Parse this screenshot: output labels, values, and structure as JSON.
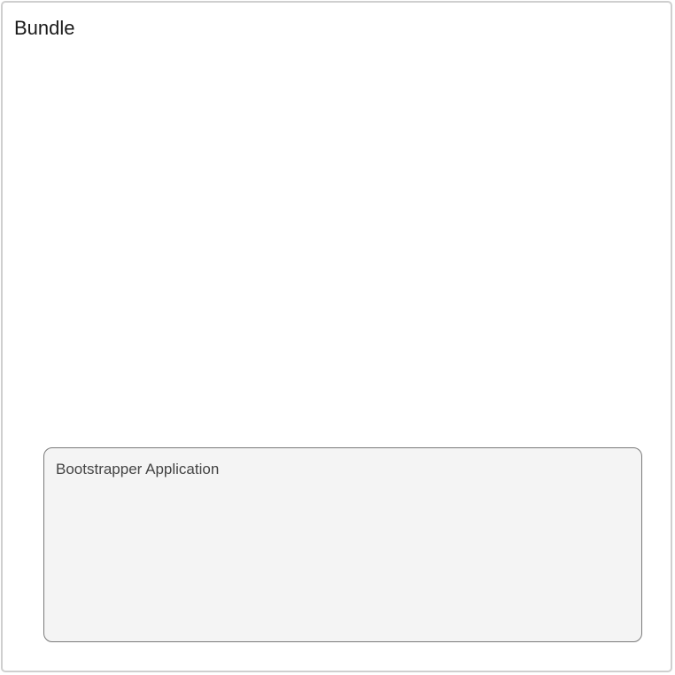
{
  "bundle": {
    "title": "Bundle"
  },
  "bootstrapper_application": {
    "label": "Bootstrapper Application"
  },
  "colors": {
    "outer_border": "#cfcfcf",
    "inner_border": "#7a7a7a",
    "inner_fill": "#f4f4f4"
  }
}
